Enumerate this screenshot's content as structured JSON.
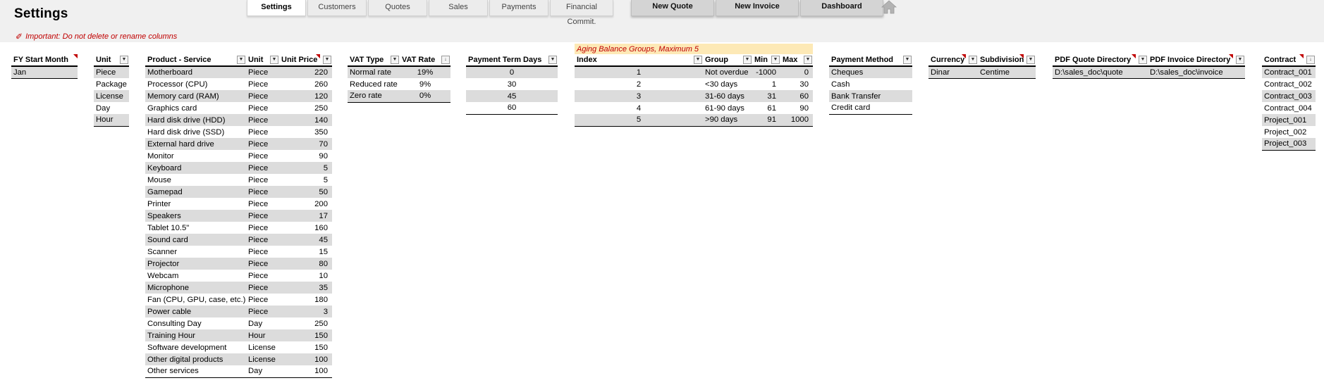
{
  "page": {
    "title": "Settings",
    "warning": "Important: Do not delete or rename columns"
  },
  "nav": {
    "tabs": [
      "Settings",
      "Customers",
      "Quotes",
      "Sales",
      "Payments",
      "Financial Commit."
    ],
    "buttons": [
      "New Quote",
      "New Invoice",
      "Dashboard"
    ],
    "active": "Settings"
  },
  "fy": {
    "header": "FY Start Month",
    "rows": [
      "Jan"
    ]
  },
  "units": {
    "header": "Unit",
    "rows": [
      "Piece",
      "Package",
      "License",
      "Day",
      "Hour"
    ]
  },
  "products": {
    "headers": [
      "Product - Service",
      "Unit",
      "Unit Price"
    ],
    "rows": [
      [
        "Motherboard",
        "Piece",
        "220"
      ],
      [
        "Processor (CPU)",
        "Piece",
        "260"
      ],
      [
        "Memory card (RAM)",
        "Piece",
        "120"
      ],
      [
        "Graphics card",
        "Piece",
        "250"
      ],
      [
        "Hard disk drive (HDD)",
        "Piece",
        "140"
      ],
      [
        "Hard disk drive (SSD)",
        "Piece",
        "350"
      ],
      [
        "External hard drive",
        "Piece",
        "70"
      ],
      [
        "Monitor",
        "Piece",
        "90"
      ],
      [
        "Keyboard",
        "Piece",
        "5"
      ],
      [
        "Mouse",
        "Piece",
        "5"
      ],
      [
        "Gamepad",
        "Piece",
        "50"
      ],
      [
        "Printer",
        "Piece",
        "200"
      ],
      [
        "Speakers",
        "Piece",
        "17"
      ],
      [
        "Tablet 10.5\"",
        "Piece",
        "160"
      ],
      [
        "Sound card",
        "Piece",
        "45"
      ],
      [
        "Scanner",
        "Piece",
        "15"
      ],
      [
        "Projector",
        "Piece",
        "80"
      ],
      [
        "Webcam",
        "Piece",
        "10"
      ],
      [
        "Microphone",
        "Piece",
        "35"
      ],
      [
        "Fan (CPU, GPU, case, etc.)",
        "Piece",
        "180"
      ],
      [
        "Power cable",
        "Piece",
        "3"
      ],
      [
        "Consulting Day",
        "Day",
        "250"
      ],
      [
        "Training Hour",
        "Hour",
        "150"
      ],
      [
        "Software development",
        "License",
        "150"
      ],
      [
        "Other digital products",
        "License",
        "100"
      ],
      [
        "Other services",
        "Day",
        "100"
      ]
    ]
  },
  "vat": {
    "headers": [
      "VAT Type",
      "VAT Rate"
    ],
    "rows": [
      [
        "Normal rate",
        "19%"
      ],
      [
        "Reduced rate",
        "9%"
      ],
      [
        "Zero rate",
        "0%"
      ]
    ]
  },
  "payment_terms": {
    "header": "Payment Term Days",
    "rows": [
      "0",
      "30",
      "45",
      "60"
    ]
  },
  "aging": {
    "caption": "Aging Balance Groups, Maximum 5",
    "headers": [
      "Index",
      "Group",
      "Min",
      "Max"
    ],
    "rows": [
      [
        "1",
        "Not overdue",
        "-1000",
        "0"
      ],
      [
        "2",
        "<30 days",
        "1",
        "30"
      ],
      [
        "3",
        "31-60 days",
        "31",
        "60"
      ],
      [
        "4",
        "61-90 days",
        "61",
        "90"
      ],
      [
        "5",
        ">90 days",
        "91",
        "1000"
      ]
    ]
  },
  "payment_methods": {
    "header": "Payment Method",
    "rows": [
      "Cheques",
      "Cash",
      "Bank Transfer",
      "Credit card"
    ]
  },
  "currency": {
    "headers": [
      "Currency",
      "Subdivision"
    ],
    "rows": [
      [
        "Dinar",
        "Centime"
      ]
    ]
  },
  "directories": {
    "headers": [
      "PDF Quote Directory",
      "PDF Invoice Directory"
    ],
    "rows": [
      [
        "D:\\sales_doc\\quote",
        "D:\\sales_doc\\invoice"
      ]
    ]
  },
  "contracts": {
    "header": "Contract",
    "rows": [
      "Contract_001",
      "Contract_002",
      "Contract_003",
      "Contract_004",
      "Project_001",
      "Project_002",
      "Project_003"
    ]
  },
  "icons": {
    "home": "home-icon",
    "dropdown": "dropdown-arrow-icon",
    "comment": "comment-indicator-icon",
    "edit": "pencil-icon"
  },
  "colors": {
    "accent": "#c00000",
    "stripe": "#dcdcdc",
    "caption_bg": "#fde9b6",
    "nav_button": "#d4d4d4"
  }
}
